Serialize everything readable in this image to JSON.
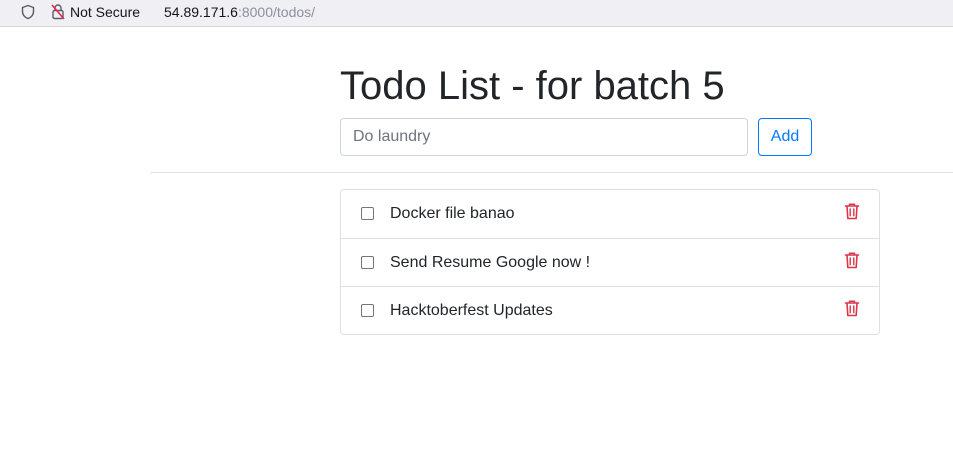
{
  "browser": {
    "security_label": "Not Secure",
    "url_host": "54.89.171.6",
    "url_rest": ":8000/todos/"
  },
  "page": {
    "title": "Todo List - for batch 5"
  },
  "form": {
    "input_placeholder": "Do laundry",
    "input_value": "",
    "add_label": "Add"
  },
  "todos": [
    {
      "label": "Docker file banao",
      "checked": false
    },
    {
      "label": "Send Resume Google now !",
      "checked": false
    },
    {
      "label": "Hacktoberfest Updates",
      "checked": false
    }
  ],
  "colors": {
    "primary": "#007bff",
    "danger": "#dc3545",
    "text": "#212529",
    "border": "#dee2e6"
  },
  "icons": {
    "tracking_protection": "shield-icon",
    "insecure": "lock-slash-icon",
    "delete": "trash-icon"
  }
}
